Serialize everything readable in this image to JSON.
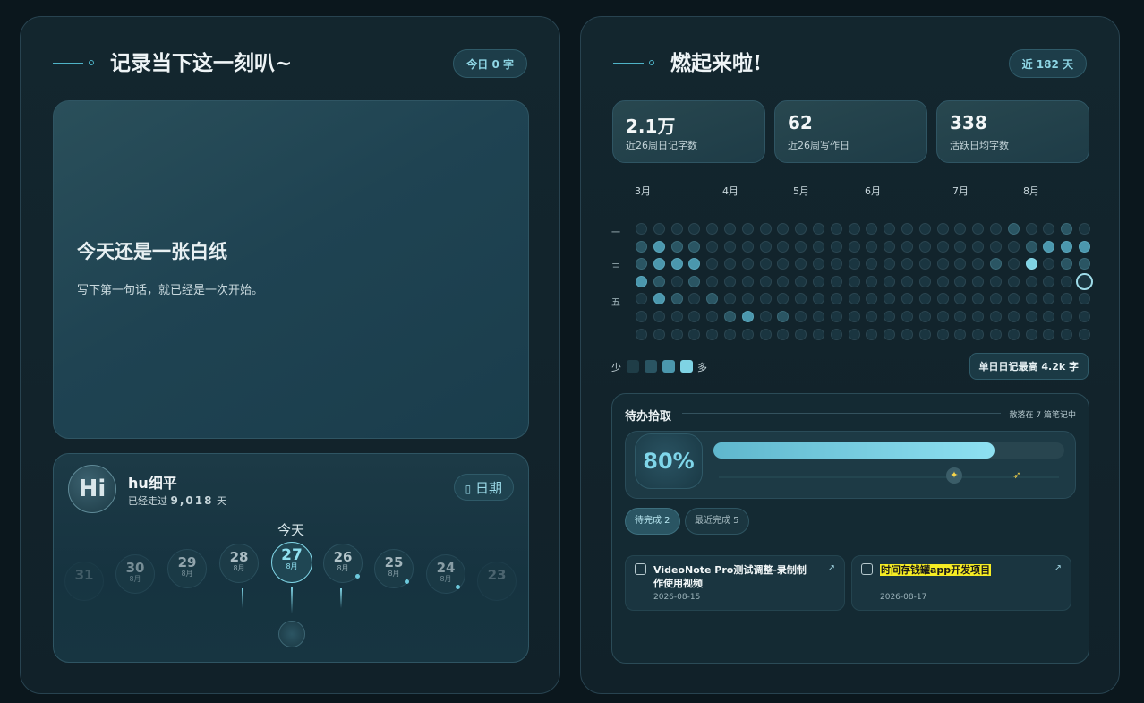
{
  "left": {
    "title": "记录当下这一刻叭~",
    "today_count": "今日 0 字",
    "blank": {
      "title": "今天还是一张白纸",
      "subtitle": "写下第一句话，就已经是一次开始。"
    },
    "profile": {
      "avatar_text": "Hi",
      "name": "hu细平",
      "days_prefix": "已经走过",
      "days_value": "9,018",
      "days_suffix": "天",
      "date_button": "日期",
      "today_label": "今天",
      "dates": [
        {
          "day": "31",
          "month": ""
        },
        {
          "day": "30",
          "month": "8月"
        },
        {
          "day": "29",
          "month": "8月"
        },
        {
          "day": "28",
          "month": "8月"
        },
        {
          "day": "27",
          "month": "8月"
        },
        {
          "day": "26",
          "month": "8月"
        },
        {
          "day": "25",
          "month": "8月"
        },
        {
          "day": "24",
          "month": "8月"
        },
        {
          "day": "23",
          "month": ""
        }
      ]
    }
  },
  "right": {
    "title": "燃起来啦!",
    "range": "近 182 天",
    "stats": [
      {
        "value": "2.1万",
        "label": "近26周日记字数"
      },
      {
        "value": "62",
        "label": "近26周写作日"
      },
      {
        "value": "338",
        "label": "活跃日均字数"
      }
    ],
    "heatmap": {
      "months": [
        "3月",
        "4月",
        "5月",
        "6月",
        "7月",
        "8月"
      ],
      "weekdays": [
        "一",
        "三",
        "五"
      ],
      "levels": "0000000000000000000001001012110000000000000000001222122200000000000000001030112101000000000000000000000002101000000000000000000000000001201000000000000000000000000000000000000000000000000000000001111000000000000000000000000",
      "highlight_week": 25,
      "highlight_day": 3
    },
    "legend": {
      "less": "少",
      "more": "多"
    },
    "max_day": "单日日记最高 4.2k 字",
    "todo": {
      "title": "待办拾取",
      "scatter": "散落在 7 篇笔记中",
      "percent": "80%",
      "progress": 0.8,
      "tab_pending": "待完成 2",
      "tab_recent": "最近完成 5",
      "tasks": [
        {
          "title": "VideoNote Pro测试调整-录制制作使用视频",
          "date": "2026-08-15"
        },
        {
          "title": "时间存钱罐app开发项目",
          "date": "2026-08-17"
        }
      ]
    }
  },
  "colors": {
    "background": "#0b171d",
    "accent": "#7fd6ea",
    "heat_levels": [
      "#1a3540",
      "#2a5563",
      "#4b97ad",
      "#7fd3e4"
    ]
  }
}
